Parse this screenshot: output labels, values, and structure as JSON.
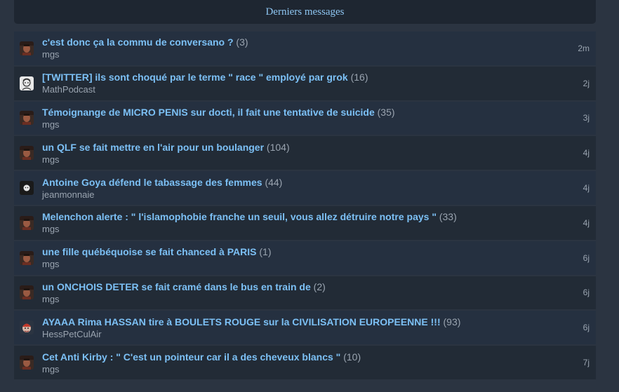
{
  "header": {
    "title": "Derniers messages"
  },
  "messages": [
    {
      "title": "c'est donc ça la commu de conversano ?",
      "count": "(3)",
      "author": "mgs",
      "time": "2m",
      "avatar": "photo"
    },
    {
      "title": "[TWITTER] ils sont choqué par le terme \" race \" employé par grok",
      "count": "(16)",
      "author": "MathPodcast",
      "time": "2j",
      "avatar": "sketch"
    },
    {
      "title": "Témoignange de MICRO PENIS sur docti, il fait une tentative de suicide",
      "count": "(35)",
      "author": "mgs",
      "time": "3j",
      "avatar": "photo"
    },
    {
      "title": "un QLF se fait mettre en l'air pour un boulanger",
      "count": "(104)",
      "author": "mgs",
      "time": "4j",
      "avatar": "photo"
    },
    {
      "title": "Antoine Goya défend le tabassage des femmes",
      "count": "(44)",
      "author": "jeanmonnaie",
      "time": "4j",
      "avatar": "dark"
    },
    {
      "title": "Melenchon alerte : \" l'islamophobie franche un seuil, vous allez détruire notre pays \"",
      "count": "(33)",
      "author": "mgs",
      "time": "4j",
      "avatar": "photo"
    },
    {
      "title": "une fille québéquoise se fait chanced à PARIS",
      "count": "(1)",
      "author": "mgs",
      "time": "6j",
      "avatar": "photo"
    },
    {
      "title": "un ONCHOIS DETER se fait cramé dans le bus en train de",
      "count": "(2)",
      "author": "mgs",
      "time": "6j",
      "avatar": "photo"
    },
    {
      "title": "AYAAA Rima HASSAN tire à BOULETS ROUGE sur la CIVILISATION EUROPEENNE !!!",
      "count": "(93)",
      "author": "HessPetCulAir",
      "time": "6j",
      "avatar": "cartoon"
    },
    {
      "title": "Cet Anti Kirby : \" C'est un pointeur car il a des cheveux blancs \"",
      "count": "(10)",
      "author": "mgs",
      "time": "7j",
      "avatar": "photo"
    }
  ]
}
